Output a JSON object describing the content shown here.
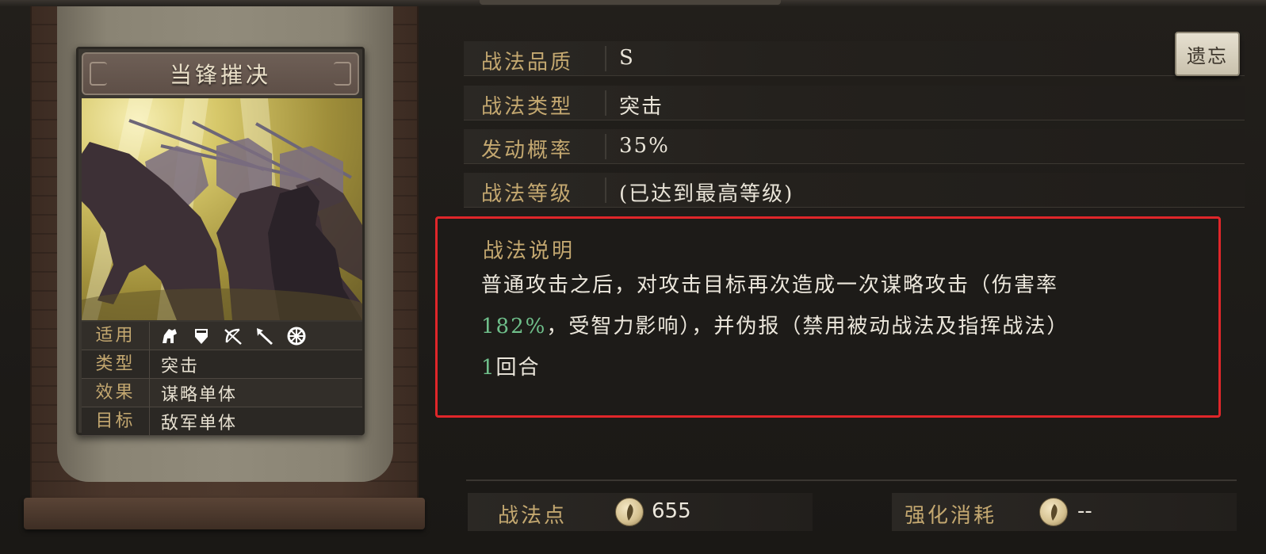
{
  "card": {
    "title": "当锋摧决",
    "attributes": {
      "applicable_label": "适用",
      "type_label": "类型",
      "type_value": "突击",
      "effect_label": "效果",
      "effect_value": "谋略单体",
      "target_label": "目标",
      "target_value": "敌军单体"
    },
    "unit_icons": [
      "cavalry-icon",
      "shield-icon",
      "bow-icon",
      "spear-icon",
      "chariot-wheel-icon"
    ]
  },
  "info": {
    "quality_label": "战法品质",
    "quality_value": "S",
    "type_label": "战法类型",
    "type_value": "突击",
    "chance_label": "发动概率",
    "chance_value": "35%",
    "level_label": "战法等级",
    "level_value": "(已达到最高等级)"
  },
  "inherit_button": "遗忘",
  "description": {
    "title": "战法说明",
    "line1": "普通攻击之后，对攻击目标再次造成一次谋略攻击（伤害率",
    "line2_highlight": "182%",
    "line2_text": "，受智力影响），并伪报（禁用被动战法及指挥战法）",
    "line3_highlight": "1",
    "line3_text": "回合"
  },
  "stats": {
    "points_label": "战法点",
    "points_value": "655",
    "cost_label": "强化消耗",
    "cost_value": "--"
  },
  "colors": {
    "label_gold": "#c4a870",
    "highlight_green": "#6fbf8a",
    "frame_red": "#e0262a"
  }
}
